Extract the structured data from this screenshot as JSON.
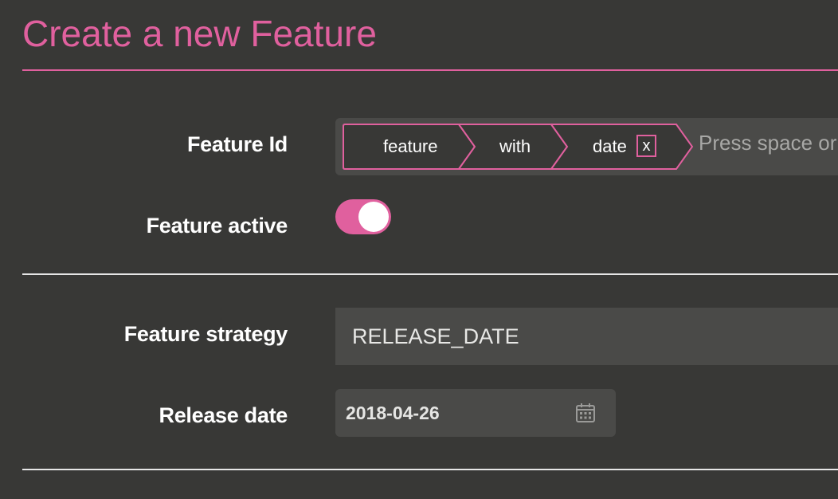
{
  "page": {
    "title": "Create a new Feature"
  },
  "form": {
    "feature_id": {
      "label": "Feature Id",
      "tags": [
        "feature",
        "with",
        "date"
      ],
      "remove_label": "x",
      "placeholder": "Press space or"
    },
    "feature_active": {
      "label": "Feature active",
      "value": true
    },
    "feature_strategy": {
      "label": "Feature strategy",
      "value": "RELEASE_DATE"
    },
    "release_date": {
      "label": "Release date",
      "value": "2018-04-26",
      "icon": "calendar-icon"
    }
  },
  "colors": {
    "accent": "#e0609e",
    "background": "#383836",
    "field": "#4a4a48",
    "text": "#ffffff",
    "placeholder": "#a8a8a6"
  }
}
